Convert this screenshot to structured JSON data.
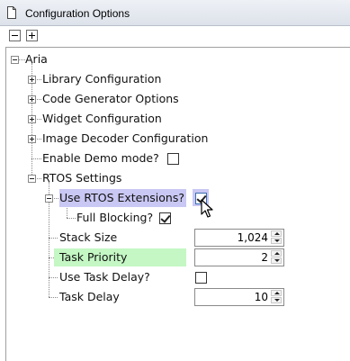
{
  "window": {
    "title": "Configuration Options"
  },
  "tree": {
    "root": "Aria",
    "items": {
      "library": "Library Configuration",
      "codegen": "Code Generator Options",
      "widget": "Widget Configuration",
      "imagedecoder": "Image Decoder Configuration",
      "demo": "Enable Demo mode?",
      "rtos": "RTOS Settings"
    },
    "rtos": {
      "use_ext": "Use RTOS Extensions?",
      "full_blocking": "Full Blocking?",
      "stack_size": "Stack Size",
      "task_priority": "Task Priority",
      "use_task_delay": "Use Task Delay?",
      "task_delay": "Task Delay"
    }
  },
  "values": {
    "demo_checked": false,
    "use_ext_checked": true,
    "full_blocking_checked": true,
    "stack_size": "1,024",
    "task_priority": "2",
    "use_task_delay_checked": false,
    "task_delay": "10"
  },
  "colors": {
    "hover_highlight": "#c9c7f3",
    "selected_highlight": "#c4f7c4"
  }
}
